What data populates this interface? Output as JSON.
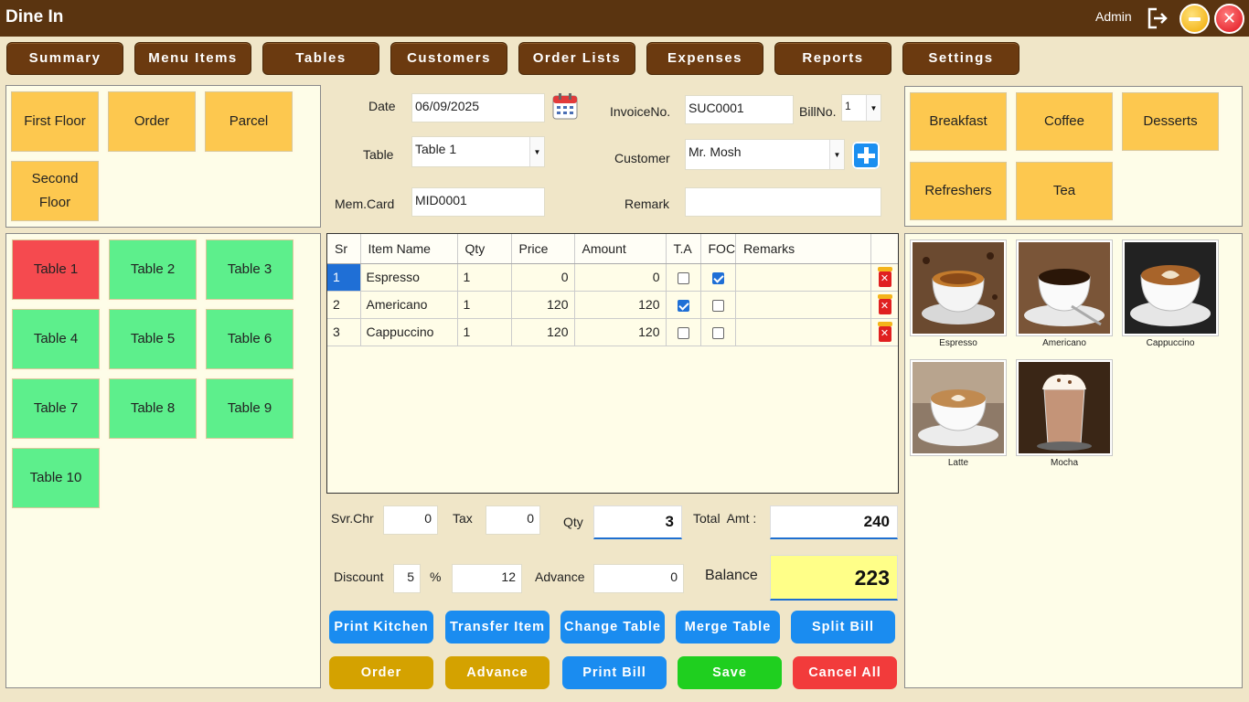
{
  "app": {
    "title": "Dine In",
    "user": "Admin"
  },
  "nav": [
    "Summary",
    "Menu Items",
    "Tables",
    "Customers",
    "Order Lists",
    "Expenses",
    "Reports",
    "Settings"
  ],
  "floors": [
    "First Floor",
    "Order",
    "Parcel",
    "Second Floor"
  ],
  "tables": [
    {
      "name": "Table 1",
      "status": "occupied"
    },
    {
      "name": "Table 2",
      "status": "free"
    },
    {
      "name": "Table 3",
      "status": "free"
    },
    {
      "name": "Table 4",
      "status": "free"
    },
    {
      "name": "Table 5",
      "status": "free"
    },
    {
      "name": "Table 6",
      "status": "free"
    },
    {
      "name": "Table 7",
      "status": "free"
    },
    {
      "name": "Table 8",
      "status": "free"
    },
    {
      "name": "Table 9",
      "status": "free"
    },
    {
      "name": "Table 10",
      "status": "free"
    }
  ],
  "form": {
    "date_label": "Date",
    "date_value": "06/09/2025",
    "invoice_label": "InvoiceNo.",
    "invoice_value": "SUC0001",
    "billno_label": "BillNo.",
    "billno_value": "1",
    "table_label": "Table",
    "table_value": "Table 1",
    "customer_label": "Customer",
    "customer_value": "Mr. Mosh",
    "memcard_label": "Mem.Card",
    "memcard_value": "MID0001",
    "remark_label": "Remark",
    "remark_value": ""
  },
  "grid": {
    "columns": [
      "Sr",
      "Item Name",
      "Qty",
      "Price",
      "Amount",
      "T.A",
      "FOC",
      "Remarks"
    ],
    "rows": [
      {
        "sr": "1",
        "item": "Espresso",
        "qty": "1",
        "price": "0",
        "amount": "0",
        "ta": false,
        "foc": true,
        "remarks": ""
      },
      {
        "sr": "2",
        "item": "Americano",
        "qty": "1",
        "price": "120",
        "amount": "120",
        "ta": true,
        "foc": false,
        "remarks": ""
      },
      {
        "sr": "3",
        "item": "Cappuccino",
        "qty": "1",
        "price": "120",
        "amount": "120",
        "ta": false,
        "foc": false,
        "remarks": ""
      }
    ]
  },
  "totals": {
    "svrchr_label": "Svr.Chr",
    "svrchr_value": "0",
    "tax_label": "Tax",
    "tax_value": "0",
    "qty_label": "Qty",
    "qty_value": "3",
    "total_label": "Total  Amt :",
    "total_value": "240",
    "discount_label": "Discount",
    "discount_percent": "5",
    "percent_sign": "%",
    "discount_value": "12",
    "advance_label": "Advance",
    "advance_value": "0",
    "balance_label": "Balance",
    "balance_value": "223"
  },
  "actions_row1": [
    "Print Kitchen",
    "Transfer Item",
    "Change Table",
    "Merge Table",
    "Split Bill"
  ],
  "actions_row2": [
    "Order",
    "Advance",
    "Print Bill",
    "Save",
    "Cancel All"
  ],
  "categories": [
    "Breakfast",
    "Coffee",
    "Desserts",
    "Refreshers",
    "Tea"
  ],
  "products": [
    "Espresso",
    "Americano",
    "Cappuccino",
    "Latte",
    "Mocha"
  ],
  "colors": {
    "titlebar": "#5a3410",
    "nav": "#6b3a10",
    "occupied": "#f54a4f",
    "free": "#5def8c",
    "tile": "#fdc84f",
    "accent_blue": "#1a8cf0"
  }
}
